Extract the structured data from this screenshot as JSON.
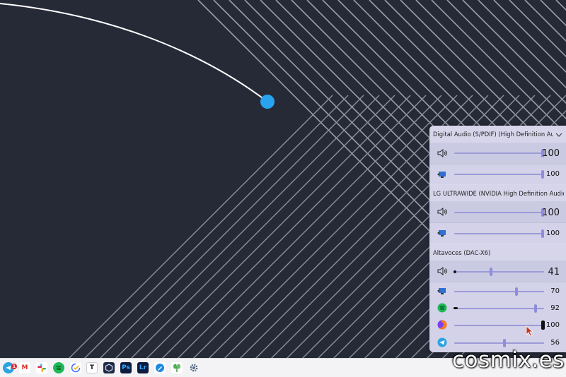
{
  "colors": {
    "wallpaper_bg": "#262a37",
    "accent_dot": "#29a3f0",
    "panel_bg": "#d8d7ec",
    "slider_accent": "#8f8ddb"
  },
  "mixer": {
    "devices": [
      {
        "name": "Digital Audio (S/PDIF) (High Definition Audio...",
        "master": {
          "icon": "speaker-icon",
          "value": "100",
          "level": 1.0
        },
        "apps": [
          {
            "icon": "system-sounds-icon",
            "value": "100",
            "level": 1.0
          }
        ]
      },
      {
        "name": "LG ULTRAWIDE (NVIDIA High Definition Audio)",
        "master": {
          "icon": "speaker-icon",
          "value": "100",
          "level": 1.0
        },
        "apps": [
          {
            "icon": "system-sounds-icon",
            "value": "100",
            "level": 1.0
          }
        ]
      },
      {
        "name": "Altavoces (DAC-X6)",
        "master": {
          "icon": "speaker-icon",
          "value": "41",
          "level": 0.41
        },
        "apps": [
          {
            "icon": "system-sounds-icon",
            "value": "70",
            "level": 0.7
          },
          {
            "icon": "spotify-icon",
            "value": "92",
            "level": 0.92
          },
          {
            "icon": "firefox-icon",
            "value": "100",
            "level": 1.0
          },
          {
            "icon": "telegram-icon",
            "value": "56",
            "level": 0.56
          }
        ]
      }
    ]
  },
  "taskbar": {
    "telegram_badge": "1",
    "icons": [
      "telegram-icon",
      "gmail-icon",
      "slack-icon",
      "spotify-icon",
      "ticktick-icon",
      "typora-icon",
      "hexagon-app-icon",
      "photoshop-icon",
      "lightroom-icon",
      "pen-app-icon",
      "plant-app-icon",
      "settings-gear-icon"
    ],
    "labels": {
      "t": "T",
      "ps": "Ps",
      "lr": "Lr",
      "gmail": "M"
    }
  },
  "watermark": "cosmix.es"
}
